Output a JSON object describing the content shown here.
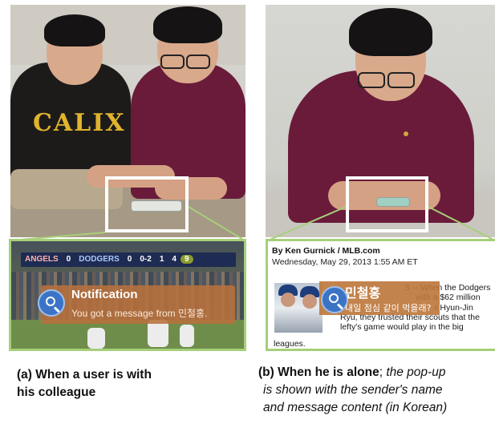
{
  "left_panel": {
    "shirt_text": "CALIX",
    "notification": {
      "title": "Notification",
      "text": "You got a message from 민철홍.",
      "scoreboard": {
        "team_a": "ANGELS",
        "score_a": "0",
        "team_b": "DODGERS",
        "score_b": "0",
        "count": "0-2",
        "outs": "1",
        "inning": "4",
        "badge": "9"
      }
    }
  },
  "right_panel": {
    "byline": "By Ken Gurnick / MLB.com",
    "dateline": "Wednesday, May 29, 2013 1:55 AM ET",
    "popup": {
      "sender": "민철홍",
      "message": "내일 점심 같이 먹을래?"
    },
    "article_lines": [
      "S -- When the Dodgers",
      "with a $62 million",
      "r Hyun-Jin",
      "Ryu, they trusted their scouts that the",
      "lefty's game would play in the big"
    ],
    "article_end": "leagues."
  },
  "captions": {
    "left_line1": "(a)  When a user is with",
    "left_line2": "his colleague",
    "right_bold": "(b) When he is alone",
    "right_sep": ";",
    "right_line1_italic": " the pop-up",
    "right_line2": "is shown with the sender's name",
    "right_line3": "and message content (in Korean)"
  },
  "colors": {
    "zoom_border": "#a7cf7a",
    "notification_bg": "#b8713c",
    "search_icon": "#3b74c6"
  }
}
